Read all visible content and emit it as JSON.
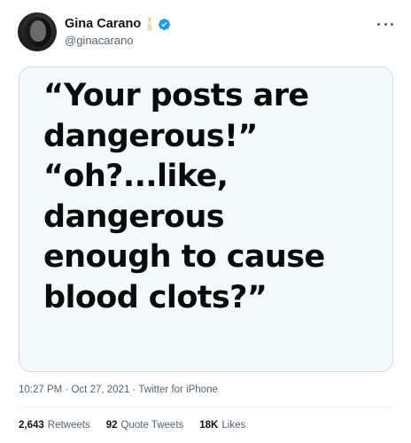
{
  "author": {
    "display_name": "Gina Carano",
    "handle": "@ginacarano",
    "name_emoji": "candle-icon",
    "verified": true,
    "verified_color": "#1d9bf0"
  },
  "tweet": {
    "image_text_lines": [
      "“Your posts are",
      "dangerous!”",
      "“oh?...like,",
      "dangerous",
      "enough to cause",
      "blood clots?”"
    ],
    "time": "10:27 PM",
    "separator": "·",
    "date": "Oct 27, 2021",
    "source": "Twitter for iPhone"
  },
  "stats": {
    "retweets_count": "2,643",
    "retweets_label": "Retweets",
    "quotes_count": "92",
    "quotes_label": "Quote Tweets",
    "likes_count": "18K",
    "likes_label": "Likes"
  },
  "colors": {
    "text_primary": "#0f1419",
    "text_secondary": "#536471",
    "media_background": "#f2fafc"
  }
}
